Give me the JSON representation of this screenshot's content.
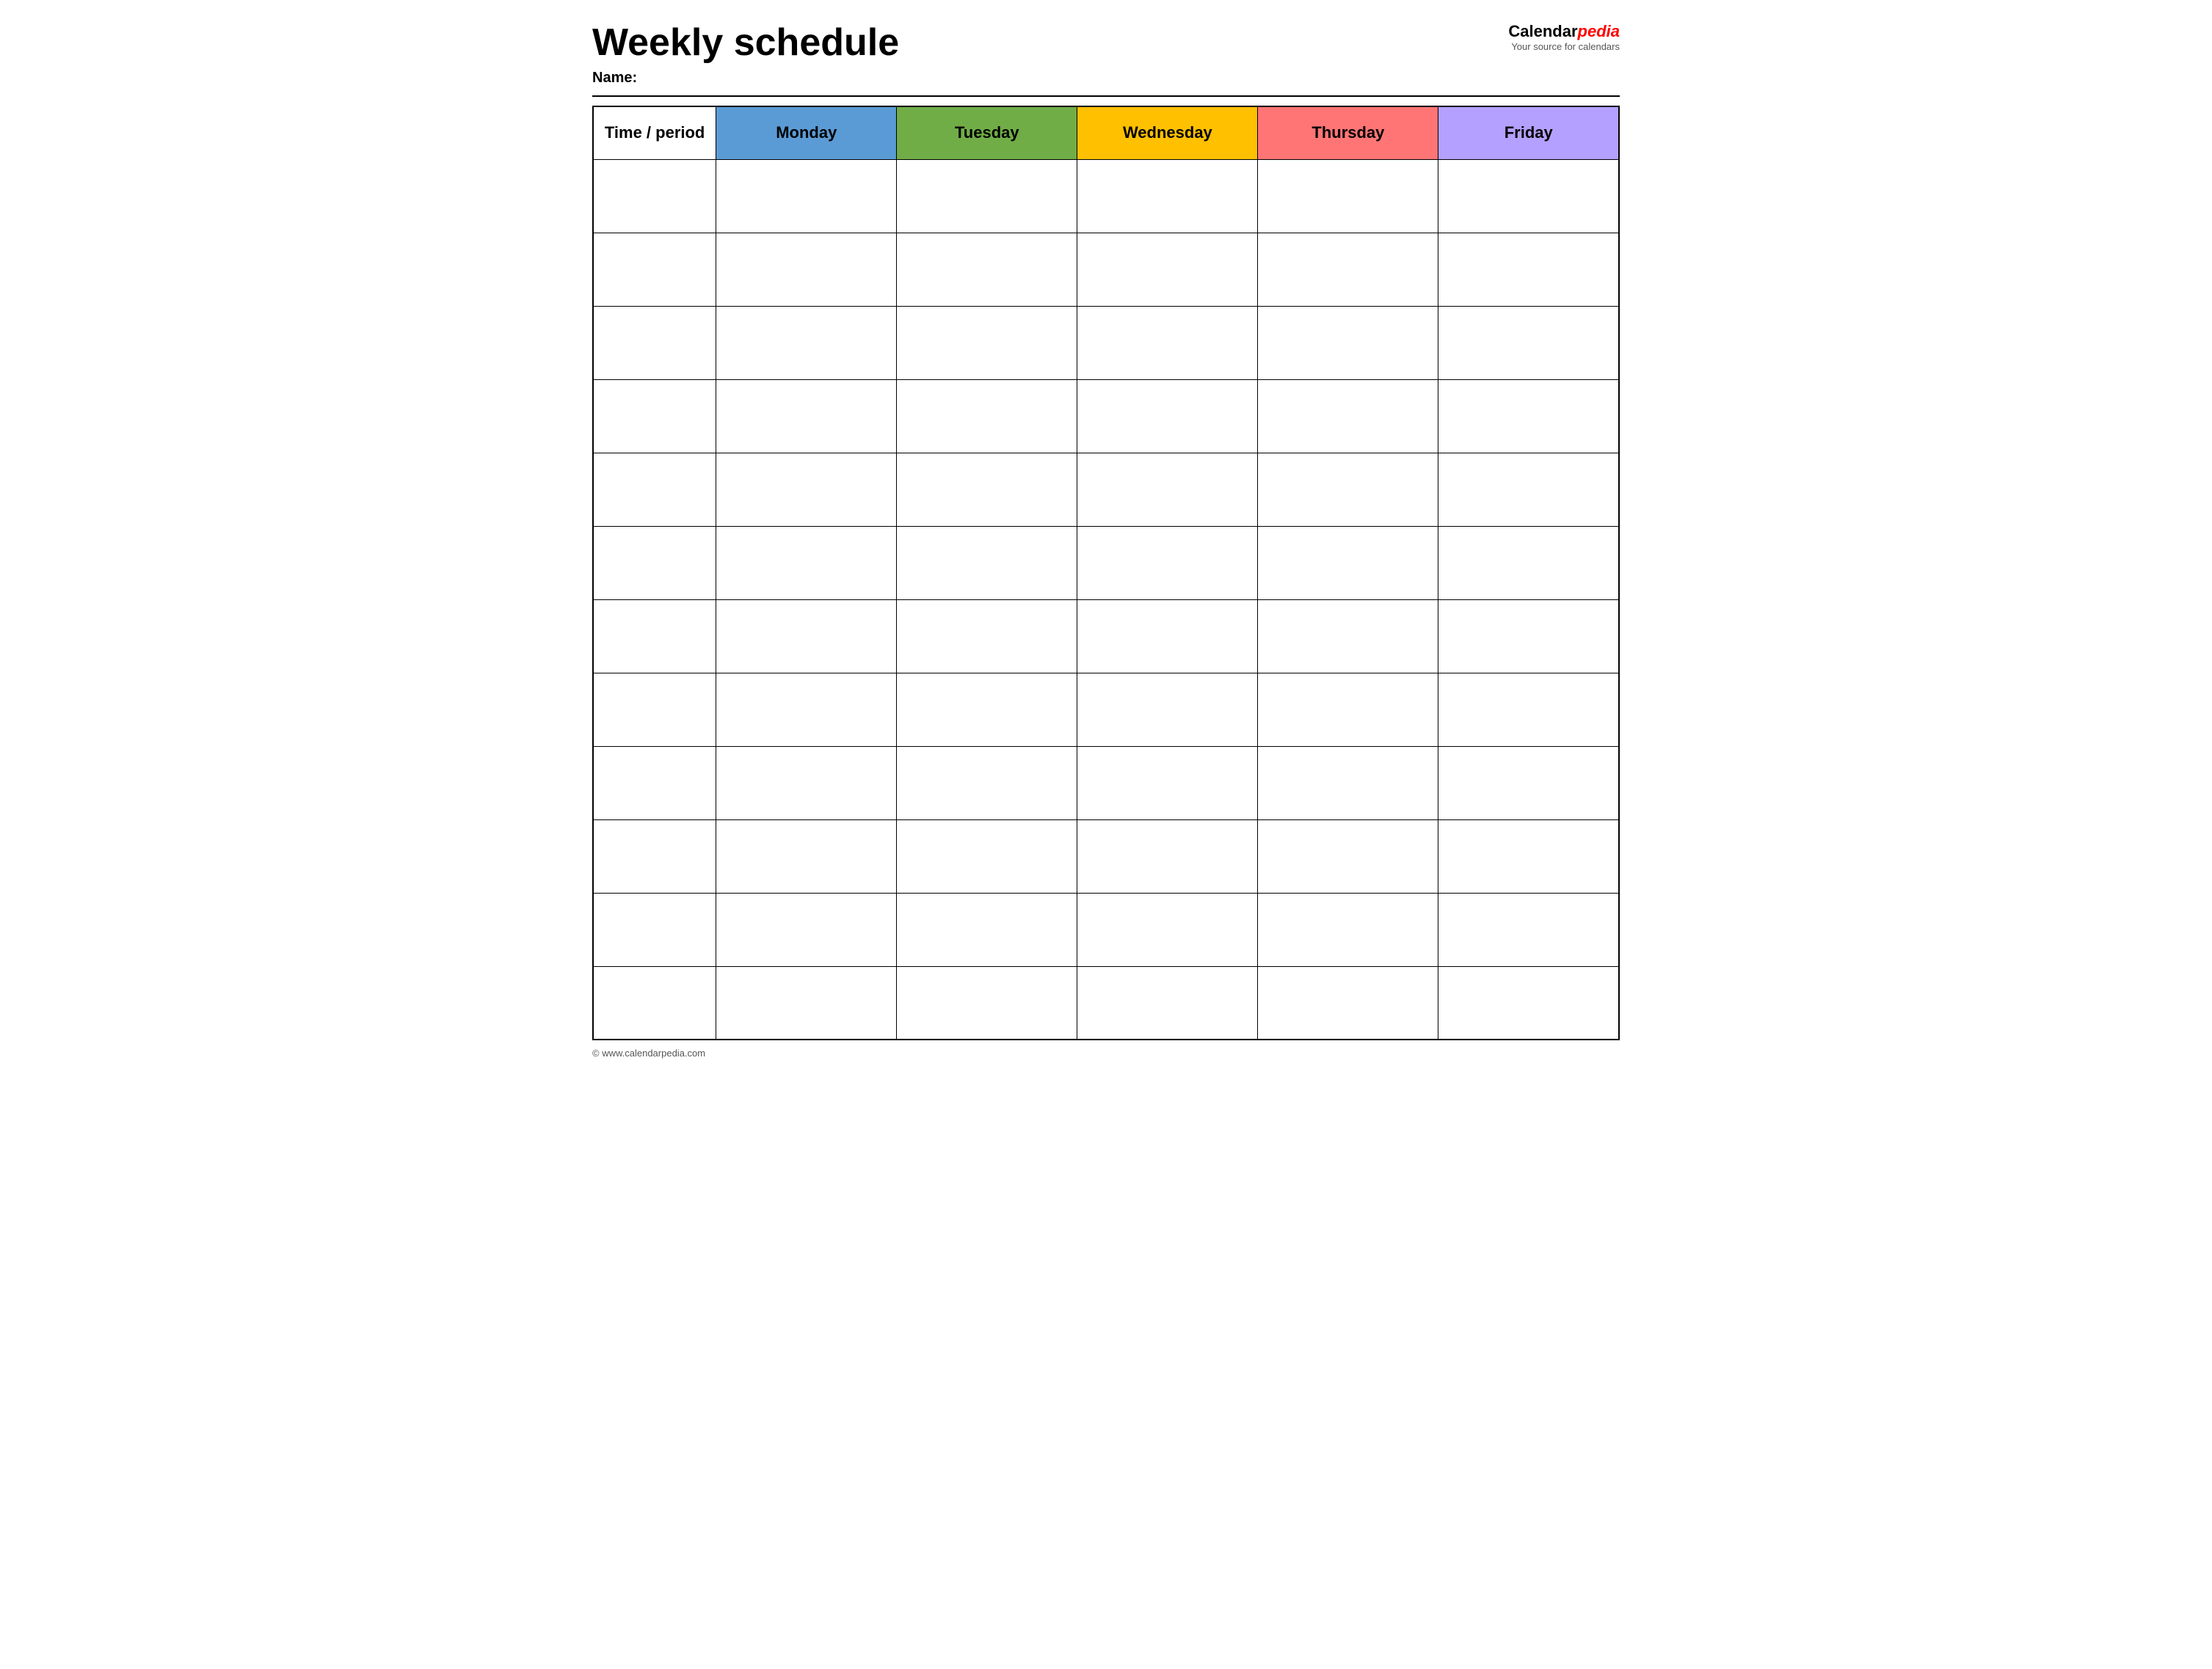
{
  "header": {
    "title": "Weekly schedule",
    "name_label": "Name:",
    "logo": {
      "text_part1": "Calendar",
      "text_part2": "pedia",
      "tagline": "Your source for calendars"
    },
    "footer_url": "© www.calendarpedia.com"
  },
  "table": {
    "columns": [
      {
        "id": "time",
        "label": "Time / period",
        "color": "#ffffff"
      },
      {
        "id": "monday",
        "label": "Monday",
        "color": "#5b9bd5"
      },
      {
        "id": "tuesday",
        "label": "Tuesday",
        "color": "#70ad47"
      },
      {
        "id": "wednesday",
        "label": "Wednesday",
        "color": "#ffc000"
      },
      {
        "id": "thursday",
        "label": "Thursday",
        "color": "#ff7575"
      },
      {
        "id": "friday",
        "label": "Friday",
        "color": "#b4a0ff"
      }
    ],
    "row_count": 12
  }
}
